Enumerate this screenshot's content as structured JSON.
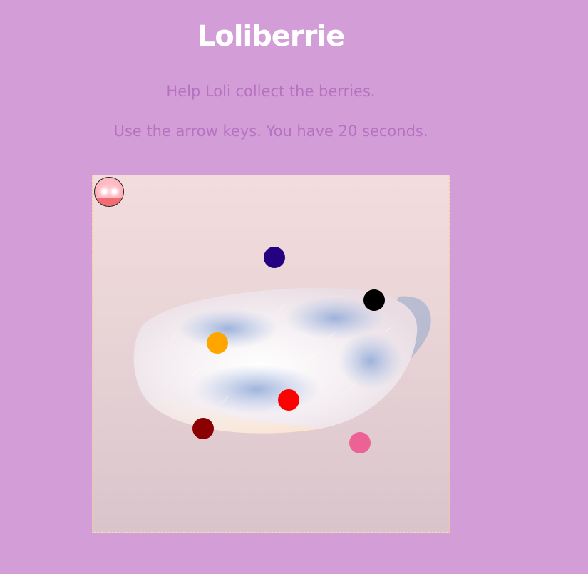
{
  "game": {
    "title": "Loliberrie",
    "instructions": [
      "Help Loli collect the berries.",
      "Use the arrow keys. You have 20 seconds."
    ]
  },
  "colors": {
    "page_background": "#d39dd8",
    "title": "#ffffff",
    "instructions": "#b572c0",
    "board_border": "#f2c9a0"
  },
  "player": {
    "name": "Loli",
    "body_color": "#ffb6c0",
    "mouth_color": "#f26d73"
  },
  "berries": [
    {
      "id": "berry-indigo",
      "color": "#250080"
    },
    {
      "id": "berry-black",
      "color": "#000000"
    },
    {
      "id": "berry-orange",
      "color": "#ffa500"
    },
    {
      "id": "berry-red",
      "color": "#ff0000"
    },
    {
      "id": "berry-darkred",
      "color": "#8b0000"
    },
    {
      "id": "berry-pink",
      "color": "#ec6294"
    }
  ]
}
